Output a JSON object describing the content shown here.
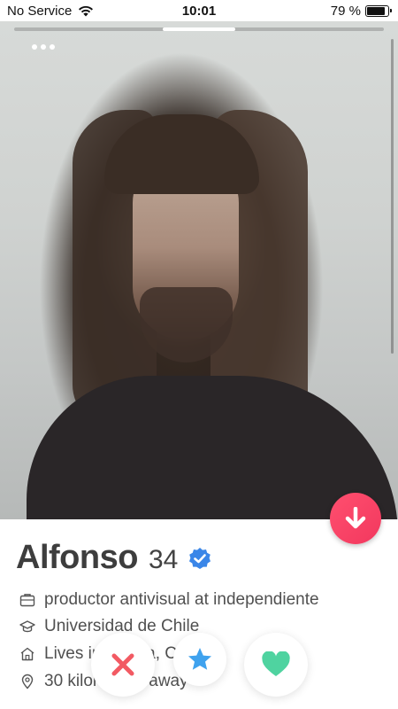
{
  "status_bar": {
    "carrier": "No Service",
    "time": "10:01",
    "battery_percent": "79 %"
  },
  "photo": {
    "indicator_count": 1,
    "current_index": 1
  },
  "profile": {
    "name": "Alfonso",
    "age": "34",
    "verified": true,
    "job": "productor antivisual at independiente",
    "school": "Universidad de Chile",
    "city": "Lives in Ñuñoa, Chile",
    "distance": "30 kilometers away"
  },
  "icons": {
    "menu": "more-dots-icon",
    "collapse": "arrow-down-icon",
    "verified": "verified-check-icon",
    "job": "briefcase-icon",
    "school": "graduation-cap-icon",
    "city": "home-icon",
    "distance": "location-pin-icon",
    "nope": "x-icon",
    "super_like": "star-icon",
    "like": "heart-icon"
  },
  "colors": {
    "accent": "#f2385e",
    "nope": "#f25a63",
    "super_like": "#3fa2ee",
    "like": "#4fd3a0",
    "verified": "#3a86e8"
  }
}
